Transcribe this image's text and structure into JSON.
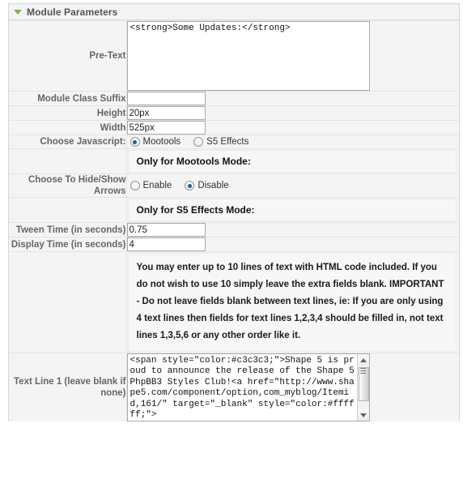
{
  "panel": {
    "title": "Module Parameters",
    "collapse_icon": "triangle-down-icon"
  },
  "fields": {
    "pretext": {
      "label": "Pre-Text",
      "value": "<strong>Some Updates:</strong>"
    },
    "module_class_suffix": {
      "label": "Module Class Suffix",
      "value": ""
    },
    "height": {
      "label": "Height",
      "value": "20px"
    },
    "width": {
      "label": "Width",
      "value": "525px"
    },
    "choose_javascript": {
      "label": "Choose Javascript:",
      "options": [
        "Mootools",
        "S5 Effects"
      ],
      "selected": "Mootools"
    },
    "mootools_note": {
      "text": "Only for Mootools Mode:"
    },
    "hide_show_arrows": {
      "label": "Choose To Hide/Show Arrows",
      "options": [
        "Enable",
        "Disable"
      ],
      "selected": "Disable"
    },
    "s5effects_note": {
      "text": "Only for S5 Effects Mode:"
    },
    "tween_time": {
      "label": "Tween Time (in seconds)",
      "value": "0.75"
    },
    "display_time": {
      "label": "Display Time (in seconds)",
      "value": "4"
    },
    "text_lines_note": {
      "text": "You may enter up to 10 lines of text with HTML code included. If you do not wish to use 10 simply leave the extra fields blank. IMPORTANT - Do not leave fields blank between text lines, ie: If you are only using 4 text lines then fields for text lines 1,2,3,4 should be filled in, not text lines 1,3,5,6 or any other order like it."
    },
    "text_line_1": {
      "label": "Text Line 1 (leave blank if none)",
      "value": "<span style=\"color:#c3c3c3;\">Shape 5 is proud to announce the release of the Shape 5 PhpBB3 Styles Club!<a href=\"http://www.shape5.com/component/option,com_myblog/Itemid,161/\" target=\"_blank\" style=\"color:#ffffff;\">"
    }
  },
  "scrollbar": {
    "up_icon": "triangle-up-icon",
    "down_icon": "triangle-down-icon",
    "thumb": "scroll-thumb"
  },
  "colors": {
    "panel_bg": "#f4f4f4",
    "accent_green": "#82b44a",
    "label_text": "#666666",
    "radio_dot": "#1b5e9e"
  }
}
